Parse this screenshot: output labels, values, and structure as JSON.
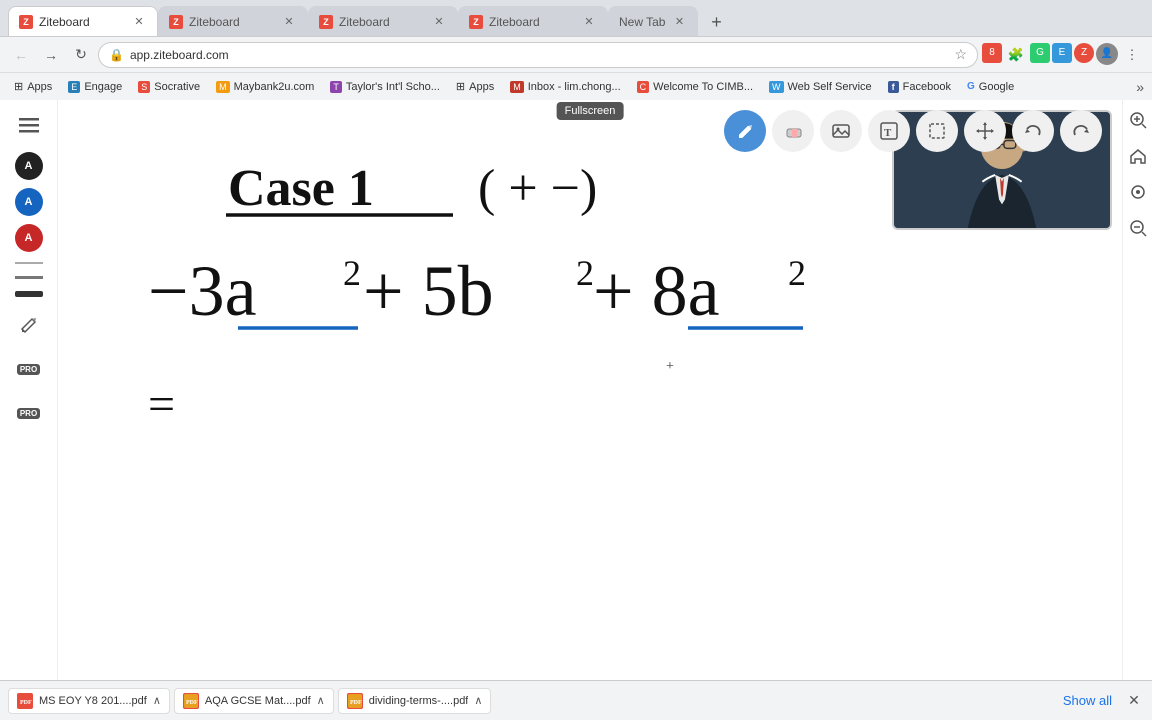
{
  "browser": {
    "tabs": [
      {
        "id": 1,
        "title": "Ziteboard",
        "active": true,
        "icon": "Z"
      },
      {
        "id": 2,
        "title": "Ziteboard",
        "active": false,
        "icon": "Z"
      },
      {
        "id": 3,
        "title": "Ziteboard",
        "active": false,
        "icon": "Z"
      },
      {
        "id": 4,
        "title": "Ziteboard",
        "active": false,
        "icon": "Z"
      },
      {
        "id": 5,
        "title": "New Tab",
        "active": false,
        "icon": ""
      }
    ],
    "address": "app.ziteboard.com"
  },
  "bookmarks": [
    {
      "label": "Apps",
      "icon": "grid"
    },
    {
      "label": "Engage",
      "icon": "E"
    },
    {
      "label": "Socrative",
      "icon": "S"
    },
    {
      "label": "Maybank2u.com",
      "icon": "M"
    },
    {
      "label": "Taylor's Int'l Scho...",
      "icon": "T"
    },
    {
      "label": "Apps",
      "icon": "grid"
    },
    {
      "label": "Inbox - lim.chong...",
      "icon": "M"
    },
    {
      "label": "Welcome To CIMB...",
      "icon": "C"
    },
    {
      "label": "Web Self Service",
      "icon": "W"
    },
    {
      "label": "Facebook",
      "icon": "f"
    },
    {
      "label": "Google",
      "icon": "G"
    }
  ],
  "toolbar": {
    "buttons": [
      {
        "name": "pen",
        "icon": "✏️",
        "active": true
      },
      {
        "name": "eraser",
        "icon": "◻",
        "active": false
      },
      {
        "name": "image",
        "icon": "🖼",
        "active": false
      },
      {
        "name": "text",
        "icon": "T",
        "active": false
      },
      {
        "name": "select",
        "icon": "⬚",
        "active": false
      },
      {
        "name": "move",
        "icon": "+",
        "active": false
      },
      {
        "name": "undo",
        "icon": "↩",
        "active": false
      },
      {
        "name": "redo",
        "icon": "↪",
        "active": false
      }
    ]
  },
  "sidebar": {
    "colors": [
      {
        "color": "#222222",
        "label": "black"
      },
      {
        "color": "#1565c0",
        "label": "blue"
      },
      {
        "color": "#c62828",
        "label": "red"
      }
    ],
    "strokeSizes": [
      {
        "size": "thin",
        "label": "thin"
      },
      {
        "size": "medium",
        "label": "medium"
      },
      {
        "size": "thick",
        "label": "thick"
      }
    ]
  },
  "whiteboard": {
    "tooltip_fullscreen": "Fullscreen"
  },
  "right_sidebar": {
    "zoom_in": "+",
    "home": "⌂",
    "center": "⊙",
    "zoom_out": "−"
  },
  "downloads": [
    {
      "name": "MS EOY Y8 201....pdf",
      "color": "#e74c3c"
    },
    {
      "name": "AQA GCSE Mat....pdf",
      "color": "#e8a020"
    },
    {
      "name": "dividing-terms-....pdf",
      "color": "#e8a020"
    }
  ],
  "downloads_bar": {
    "show_all": "Show all"
  }
}
